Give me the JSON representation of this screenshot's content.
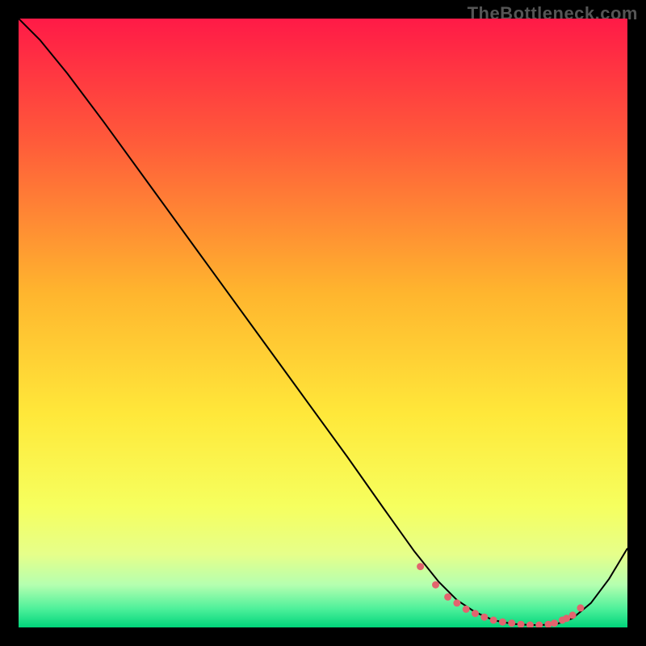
{
  "attribution": "TheBottleneck.com",
  "chart_data": {
    "type": "line",
    "title": "",
    "xlabel": "",
    "ylabel": "",
    "xlim": [
      0,
      100
    ],
    "ylim": [
      0,
      100
    ],
    "grid": false,
    "legend": false,
    "background_gradient": {
      "direction": "vertical",
      "stops": [
        {
          "offset": 0.0,
          "color": "#ff1a47"
        },
        {
          "offset": 0.2,
          "color": "#ff5a3a"
        },
        {
          "offset": 0.45,
          "color": "#ffb52e"
        },
        {
          "offset": 0.65,
          "color": "#ffe83a"
        },
        {
          "offset": 0.8,
          "color": "#f6ff5e"
        },
        {
          "offset": 0.88,
          "color": "#e6ff8a"
        },
        {
          "offset": 0.93,
          "color": "#b5ffb0"
        },
        {
          "offset": 0.97,
          "color": "#4cf09a"
        },
        {
          "offset": 1.0,
          "color": "#00d47a"
        }
      ]
    },
    "series": [
      {
        "name": "curve",
        "type": "line",
        "color": "#000000",
        "x": [
          0.0,
          3.5,
          8.0,
          14.0,
          22.0,
          30.0,
          38.0,
          46.0,
          54.0,
          60.0,
          65.0,
          69.0,
          72.0,
          75.0,
          78.0,
          81.0,
          84.0,
          86.0,
          88.5,
          91.0,
          94.0,
          97.0,
          100.0
        ],
        "y": [
          100.0,
          96.5,
          91.0,
          83.0,
          72.0,
          61.0,
          50.0,
          39.0,
          28.0,
          19.5,
          12.5,
          7.5,
          4.5,
          2.5,
          1.2,
          0.6,
          0.4,
          0.4,
          0.6,
          1.5,
          4.0,
          8.0,
          13.0
        ]
      },
      {
        "name": "bottom-markers",
        "type": "scatter",
        "color": "#e2646e",
        "shape": "circle",
        "radius": 4.5,
        "x": [
          66.0,
          68.5,
          70.5,
          72.0,
          73.5,
          75.0,
          76.5,
          78.0,
          79.5,
          81.0,
          82.5,
          84.0,
          85.5,
          87.0,
          88.0,
          89.3,
          90.0,
          91.0,
          92.3
        ],
        "y": [
          10.0,
          7.0,
          5.0,
          4.0,
          3.0,
          2.3,
          1.7,
          1.2,
          0.9,
          0.7,
          0.5,
          0.4,
          0.4,
          0.5,
          0.7,
          1.2,
          1.5,
          2.0,
          3.2
        ]
      }
    ]
  }
}
